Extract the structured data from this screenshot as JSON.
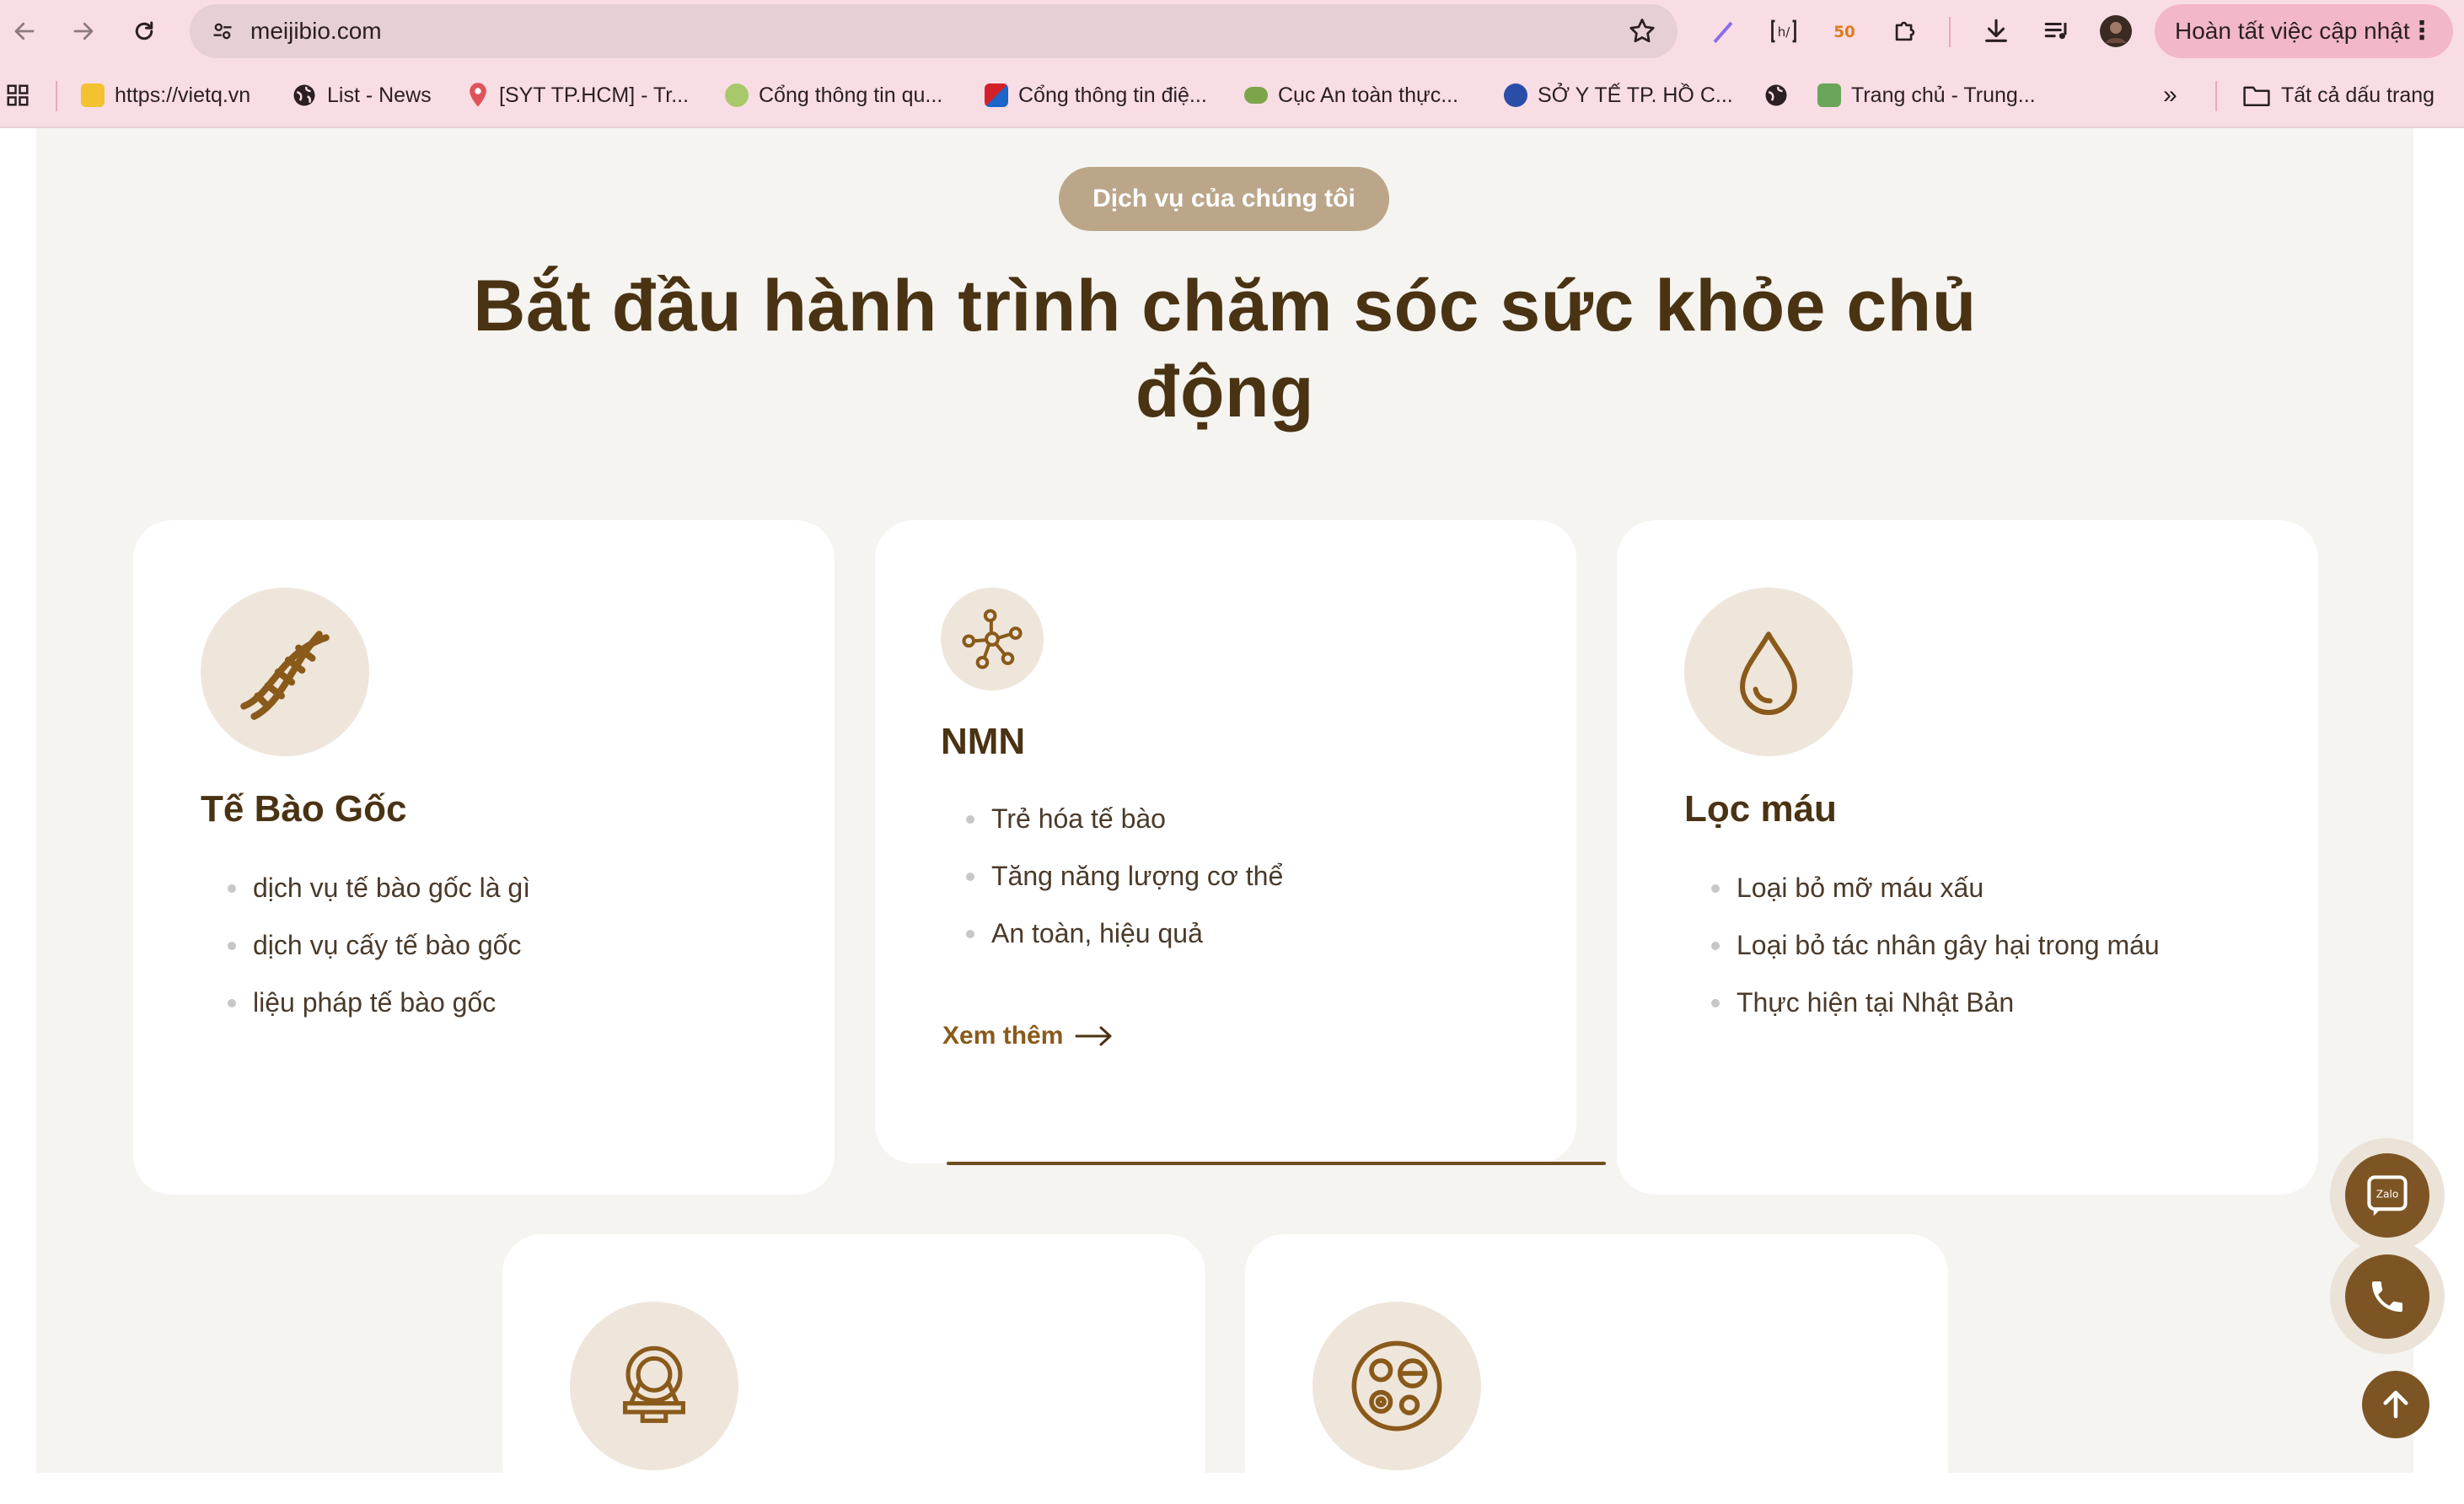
{
  "browser": {
    "url": "meijibio.com",
    "update_button": "Hoàn tất việc cập nhật",
    "bookmarks": [
      {
        "label": "https://vietq.vn"
      },
      {
        "label": "List - News"
      },
      {
        "label": "[SYT TP.HCM] - Tr..."
      },
      {
        "label": "Cổng thông tin qu..."
      },
      {
        "label": "Cổng thông tin điệ..."
      },
      {
        "label": "Cục An toàn thực..."
      },
      {
        "label": "SỞ Y TẾ TP. HỒ C..."
      },
      {
        "label": "Trang chủ - Trung..."
      }
    ],
    "all_bookmarks": "Tất cả dấu trang"
  },
  "section": {
    "badge": "Dịch vụ của chúng tôi",
    "heading": "Bắt đầu hành trình chăm sóc sức khỏe chủ động"
  },
  "cards": [
    {
      "title": "Tế Bào Gốc",
      "icon": "dna-icon",
      "items": [
        "dịch vụ tế bào gốc là gì",
        "dịch vụ cấy tế bào gốc",
        "liệu pháp tế bào gốc"
      ]
    },
    {
      "title": "NMN",
      "icon": "molecule-icon",
      "items": [
        "Trẻ hóa tế bào",
        "Tăng năng lượng cơ thể",
        "An toàn, hiệu quả"
      ],
      "more": "Xem thêm"
    },
    {
      "title": "Lọc máu",
      "icon": "blood-drop-icon",
      "items": [
        "Loại bỏ mỡ máu xấu",
        "Loại bỏ tác nhân gây hại trong máu",
        "Thực hiện tại Nhật Bản"
      ]
    },
    {
      "icon": "scanner-icon"
    },
    {
      "icon": "cells-icon"
    }
  ],
  "floating": {
    "zalo_label": "Zalo"
  },
  "colors": {
    "chrome": "#f9dde5",
    "brand_brown": "#4a3313",
    "accent_brown": "#8a5a1b",
    "badge": "#bba68a",
    "icon_bg": "#efe6db",
    "section_bg": "#f5f4f1"
  }
}
